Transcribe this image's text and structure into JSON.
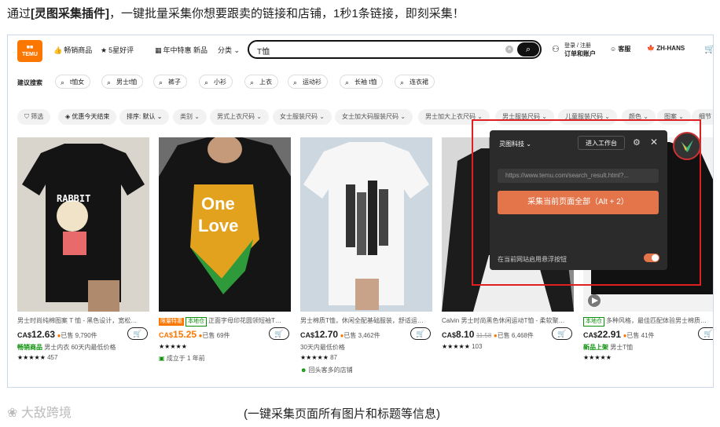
{
  "intro": {
    "prefix": "通过",
    "bold": "[灵图采集插件]",
    "suffix": "，一键批量采集你想要跟卖的链接和店铺，1秒1条链接，即刻采集！"
  },
  "topbar": {
    "logo_text": "TEMU",
    "nav": [
      "畅销商品",
      "5星好评",
      "年中特惠",
      "新品",
      "分类"
    ],
    "search_value": "T恤",
    "account_line1": "登录 / 注册",
    "account_line2": "订单和账户",
    "support": "客服",
    "lang": "ZH-HANS"
  },
  "suggest": {
    "label": "建议搜索",
    "chips": [
      "t恤女",
      "男士t恤",
      "裤子",
      "小衫",
      "上衣",
      "运动衫",
      "长袖 t恤",
      "连衣裙"
    ]
  },
  "filters": [
    "筛选",
    "优惠今天结束",
    "排序: 默认",
    "类别",
    "男式上衣尺码",
    "女士服装尺码",
    "女士加大码服装尺码",
    "男士加大上衣尺码",
    "男士服装尺码",
    "儿童服装尺码",
    "颜色",
    "图案",
    "细节"
  ],
  "products": [
    {
      "title": "男士时尚纯棉图案 T 恤 - 黑色设计，宽松…",
      "tags": [],
      "currency": "CA$",
      "price": "12.63",
      "old_price": "",
      "sold": "已售 9,790件",
      "line3_highlight": "畅销商品",
      "line3_text": "男士内衣  60天内最低价格",
      "stars": "★★★★★",
      "reviews": "457",
      "line5": "",
      "image_text": "RABBIT"
    },
    {
      "title": "正面字母印花圆领短袖T…",
      "tags": [
        {
          "text": "限量特惠",
          "style": "orange"
        },
        {
          "text": "本地仓",
          "style": "green"
        }
      ],
      "currency": "CA$",
      "price": "15.25",
      "old_price": "",
      "sold": "已售 69件",
      "line3_highlight": "",
      "line3_text": "★★★★★",
      "stars": "",
      "reviews": "",
      "line4_alt": "成立于 1 年前",
      "line5": "",
      "image_text": "One Love"
    },
    {
      "title": "男士棉质T恤，休闲全配基础服装，舒适运…",
      "tags": [],
      "currency": "CA$",
      "price": "12.70",
      "old_price": "",
      "sold": "已售 3,462件",
      "line3_highlight": "",
      "line3_text": "30天内最低价格",
      "stars": "★★★★★",
      "reviews": "87",
      "line5": "回头客多的店铺",
      "image_text": ""
    },
    {
      "title": "Calvin 男士时尚黑色休闲运动T恤 - 柔软聚…",
      "tags": [],
      "currency": "CA$",
      "price": "8.10",
      "old_price": "11.58",
      "sold": "已售 6,468件",
      "line3_highlight": "",
      "line3_text": "",
      "stars": "★★★★★",
      "reviews": "103",
      "line5": "",
      "image_text": ""
    },
    {
      "title": "多种风格，最佳匹配体验男士棉质…",
      "tags": [
        {
          "text": "本地仓",
          "style": "green"
        }
      ],
      "currency": "CA$",
      "price": "22.91",
      "old_price": "",
      "sold": "已售 41件",
      "line3_highlight": "新品上架",
      "line3_text": "男士T恤",
      "stars": "★★★★★",
      "reviews": "",
      "line5": "",
      "image_text": ""
    }
  ],
  "plugin": {
    "brand": "灵图科技",
    "workspace_btn": "进入工作台",
    "url": "https://www.temu.com/search_result.html?...",
    "collect_btn": "采集当前页面全部（Alt + 2）",
    "toggle_label": "在当前网站启用悬浮按钮",
    "toggle_on": true,
    "accent": "#e4744a"
  },
  "footer": {
    "logo": "大敌跨境",
    "caption": "(一键采集页面所有图片和标题等信息)"
  }
}
